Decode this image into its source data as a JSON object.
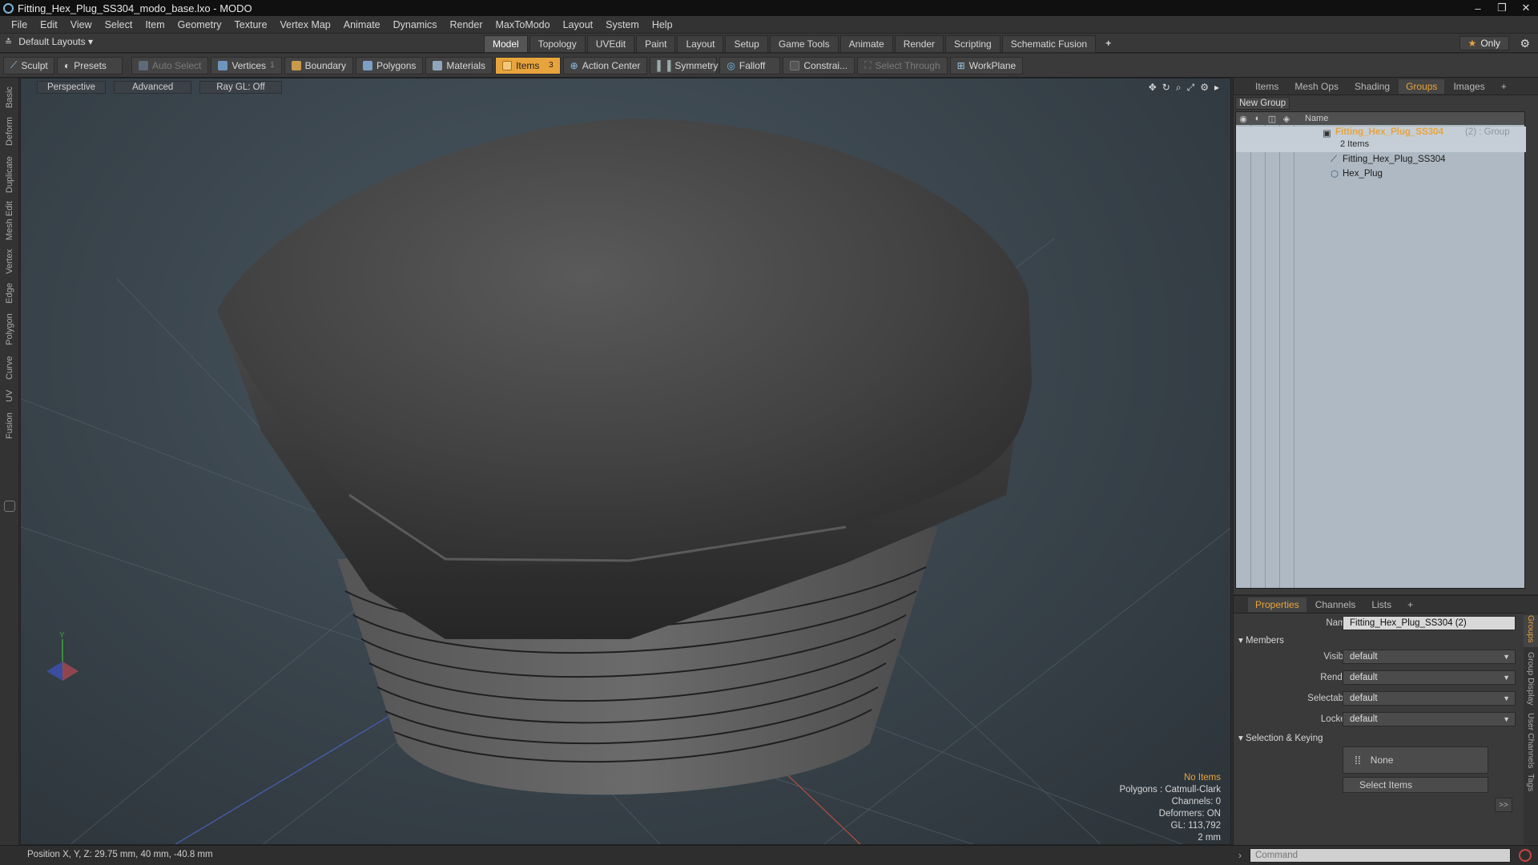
{
  "window": {
    "title": "Fitting_Hex_Plug_SS304_modo_base.lxo - MODO",
    "controls": [
      "–",
      "❐",
      "✕"
    ]
  },
  "menu": [
    "File",
    "Edit",
    "View",
    "Select",
    "Item",
    "Geometry",
    "Texture",
    "Vertex Map",
    "Animate",
    "Dynamics",
    "Render",
    "MaxToModo",
    "Layout",
    "System",
    "Help"
  ],
  "layout_bar": {
    "layout_selector": "Default Layouts ▾",
    "tabs": [
      "Model",
      "Topology",
      "UVEdit",
      "Paint",
      "Layout",
      "Setup",
      "Game Tools",
      "Animate",
      "Render",
      "Scripting",
      "Schematic Fusion"
    ],
    "active_tab": "Model",
    "add": "+",
    "only": "Only"
  },
  "toolbar": {
    "sculpt": "Sculpt",
    "presets": "Presets",
    "auto_select": "Auto Select",
    "vertices": "Vertices",
    "vertices_count": "1",
    "boundary": "Boundary",
    "polygons": "Polygons",
    "materials": "Materials",
    "items": "Items",
    "items_count": "3",
    "action_center": "Action Center",
    "symmetry": "Symmetry",
    "falloff": "Falloff",
    "constrain": "Constrai...",
    "select_through": "Select Through",
    "workplane": "WorkPlane"
  },
  "left_tabs": [
    "Basic",
    "Deform",
    "Duplicate",
    "Mesh Edit",
    "Vertex",
    "Edge",
    "Polygon",
    "Curve",
    "UV",
    "Fusion"
  ],
  "viewport": {
    "perspective": "Perspective",
    "advanced": "Advanced",
    "raygl": "Ray GL: Off",
    "info": {
      "no_items": "No Items",
      "polygons": "Polygons : Catmull-Clark",
      "channels": "Channels: 0",
      "deformers": "Deformers: ON",
      "gl": "GL: 113,792",
      "scale": "2 mm"
    },
    "axis": {
      "y": "Y"
    }
  },
  "groups_panel": {
    "tabs": [
      "Items",
      "Mesh Ops",
      "Shading",
      "Groups",
      "Images"
    ],
    "active_tab": "Groups",
    "new_group": "New Group",
    "name_header": "Name",
    "group_name": "Fitting_Hex_Plug_SS304",
    "group_suffix": "(2) : Group",
    "group_count": "2 Items",
    "children": [
      "Fitting_Hex_Plug_SS304",
      "Hex_Plug"
    ]
  },
  "properties": {
    "tabs": [
      "Properties",
      "Channels",
      "Lists"
    ],
    "active_tab": "Properties",
    "name_label": "Name",
    "name_value": "Fitting_Hex_Plug_SS304 (2)",
    "members_section": "Members",
    "visible_label": "Visible",
    "visible_value": "default",
    "render_label": "Render",
    "render_value": "default",
    "selectable_label": "Selectable",
    "selectable_value": "default",
    "locked_label": "Locked",
    "locked_value": "default",
    "selection_section": "Selection & Keying",
    "none_label": "None",
    "select_items": "Select Items",
    "more": ">>",
    "side_tabs": [
      "Groups",
      "Group Display",
      "User Channels",
      "Tags"
    ]
  },
  "status": {
    "position": "Position X, Y, Z:  29.75 mm, 40 mm, -40.8 mm",
    "command_placeholder": "Command"
  },
  "colors": {
    "accent": "#e8a43c",
    "group_bg": "#aeb9c3"
  }
}
